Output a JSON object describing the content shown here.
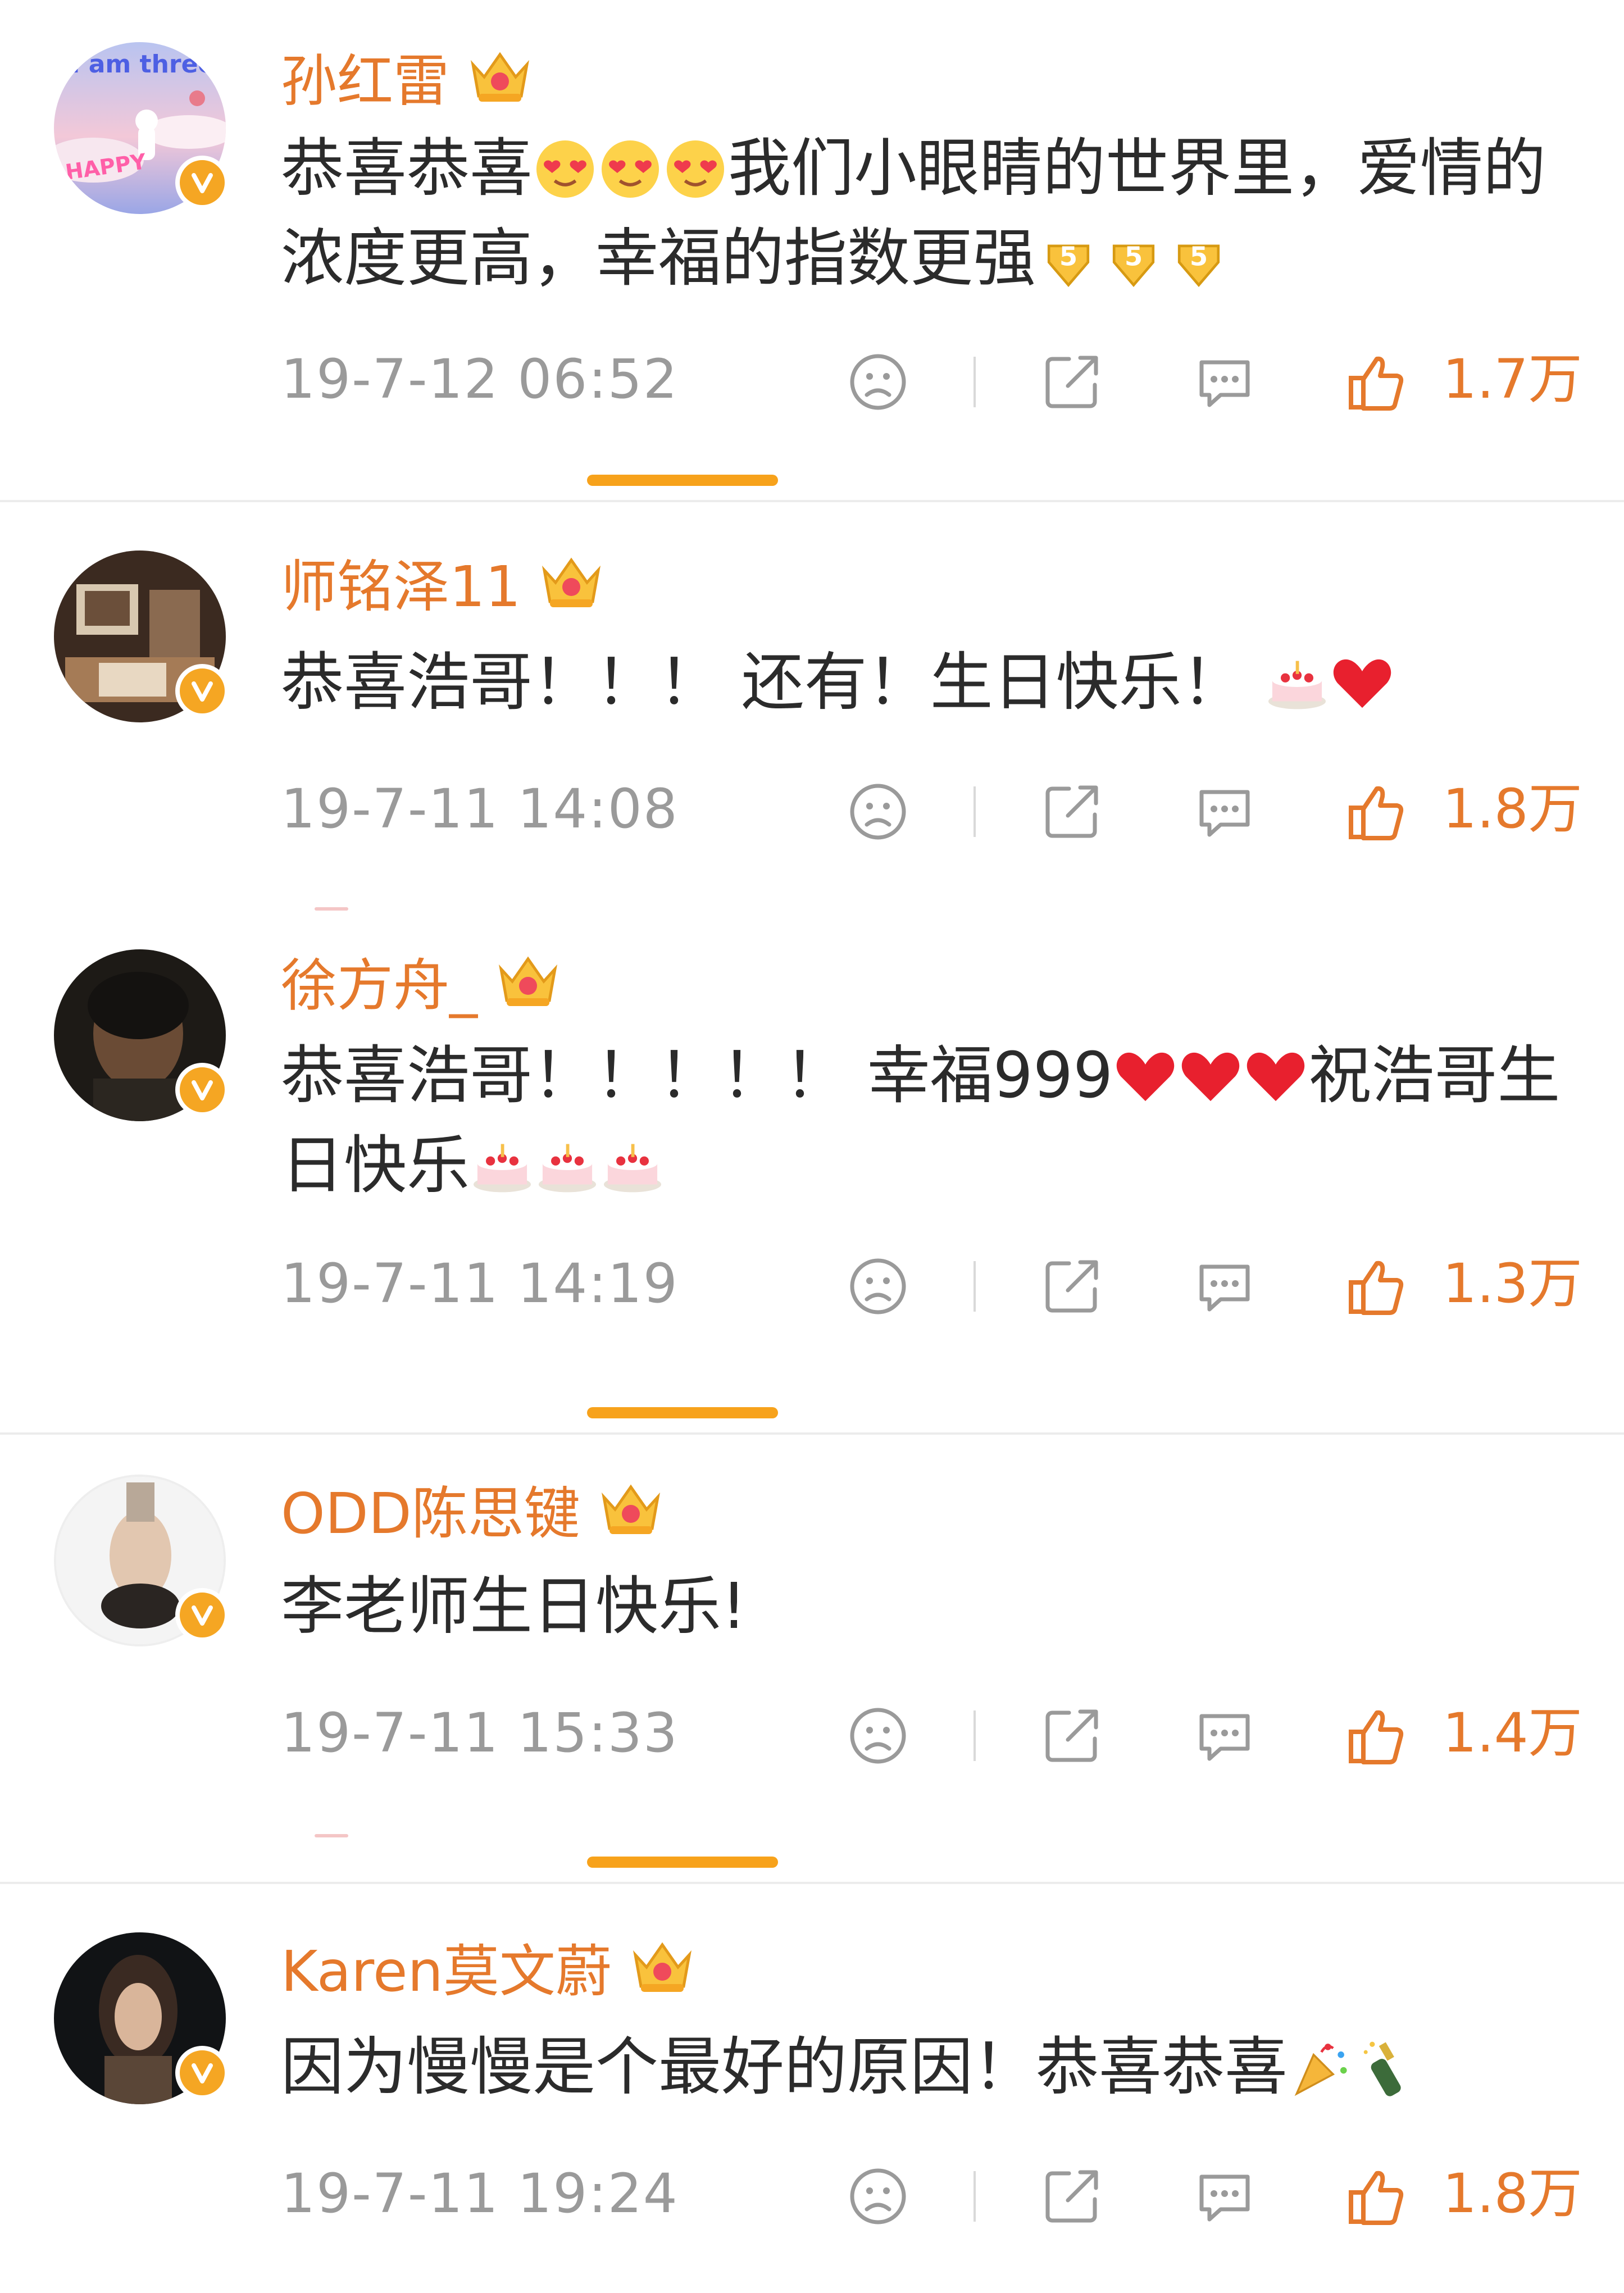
{
  "colors": {
    "username": "#e5792c",
    "like": "#e5792c",
    "badge": "#f5a623",
    "indicator": "#f7a21b",
    "timestamp": "#9a9a9a"
  },
  "comments": [
    {
      "username": "孙红雷",
      "text_parts": [
        "恭喜恭喜",
        "我们小眼睛的世界里，爱情的浓度更高，幸福的指数更强"
      ],
      "emoji_names": [
        "heart-eyes-emoji",
        "heart-eyes-emoji",
        "heart-eyes-emoji",
        "five-star-emoji",
        "five-star-emoji",
        "five-star-emoji"
      ],
      "avatar_text": "I am three",
      "avatar_text2": "HAPPY",
      "timestamp": "19-7-12 06:52",
      "likes": "1.7万"
    },
    {
      "username": "师铭泽11",
      "text_parts": [
        "恭喜浩哥！！！ 还有！生日快乐！ "
      ],
      "emoji_names": [
        "cake-emoji",
        "red-heart-emoji"
      ],
      "timestamp": "19-7-11 14:08",
      "likes": "1.8万"
    },
    {
      "username": "徐方舟_",
      "text_parts": [
        "恭喜浩哥！！！！！ 幸福999",
        "祝浩哥生日快乐"
      ],
      "emoji_names": [
        "red-heart-emoji",
        "red-heart-emoji",
        "red-heart-emoji",
        "cake-emoji",
        "cake-emoji",
        "cake-emoji"
      ],
      "timestamp": "19-7-11 14:19",
      "likes": "1.3万"
    },
    {
      "username": "ODD陈思键",
      "text_parts": [
        "李老师生日快乐!"
      ],
      "emoji_names": [],
      "timestamp": "19-7-11 15:33",
      "likes": "1.4万"
    },
    {
      "username": "Karen莫文蔚",
      "text_parts": [
        "因为慢慢是个最好的原因！恭喜恭喜"
      ],
      "emoji_names": [
        "party-popper-emoji",
        "champagne-emoji"
      ],
      "timestamp": "19-7-11 19:24",
      "likes": "1.8万"
    }
  ]
}
